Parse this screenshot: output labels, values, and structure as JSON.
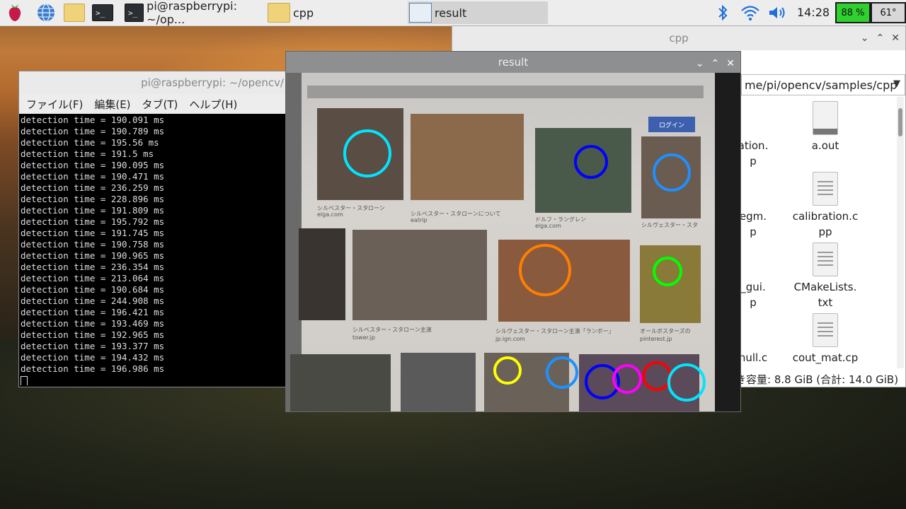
{
  "taskbar": {
    "tasks": [
      {
        "label": "pi@raspberrypi: ~/op..."
      },
      {
        "label": "cpp"
      },
      {
        "label": "result"
      }
    ],
    "clock": "14:28",
    "cpu_usage": "88 %",
    "temperature": "61°"
  },
  "file_manager": {
    "title": "cpp",
    "path": "me/pi/opencv/samples/cpp",
    "files": [
      {
        "name": "ation.",
        "name2": "p"
      },
      {
        "name": "a.out",
        "name2": ""
      },
      {
        "name": "egm.",
        "name2": "p"
      },
      {
        "name": "calibration.c",
        "name2": "pp"
      },
      {
        "name": "_gui.",
        "name2": "p"
      },
      {
        "name": "CMakeLists.",
        "name2": "txt"
      },
      {
        "name": "hull.c",
        "name2": ""
      },
      {
        "name": "cout_mat.cp",
        "name2": ""
      }
    ],
    "status": "き容量: 8.8 GiB (合計: 14.0 GiB)"
  },
  "terminal": {
    "title": "pi@raspberrypi: ~/opencv/",
    "menu": [
      "ファイル(F)",
      "編集(E)",
      "タブ(T)",
      "ヘルプ(H)"
    ],
    "lines": [
      "detection time = 190.091 ms",
      "detection time = 190.789 ms",
      "detection time = 195.56 ms",
      "detection time = 191.5 ms",
      "detection time = 190.095 ms",
      "detection time = 190.471 ms",
      "detection time = 236.259 ms",
      "detection time = 228.896 ms",
      "detection time = 191.809 ms",
      "detection time = 195.792 ms",
      "detection time = 191.745 ms",
      "detection time = 190.758 ms",
      "detection time = 190.965 ms",
      "detection time = 236.354 ms",
      "detection time = 213.064 ms",
      "detection time = 190.684 ms",
      "detection time = 244.908 ms",
      "detection time = 196.421 ms",
      "detection time = 193.469 ms",
      "detection time = 192.965 ms",
      "detection time = 193.377 ms",
      "detection time = 194.432 ms",
      "detection time = 196.986 ms"
    ]
  },
  "result_window": {
    "title": "result",
    "captions": [
      "シルベスター・スタローン",
      "elga.com",
      "シルベスター・スタローンについて",
      "eatrip",
      "ドルフ・ラングレン",
      "elga.com",
      "シルヴェスター・スタ",
      "ログイン",
      "シルベスター・スタローン主演",
      "tower.jp",
      "シルヴェスター・スタローン主演「ランボー」",
      "jp.ign.com",
      "オールボスターズの",
      "pinterest.jp"
    ]
  },
  "colors": {
    "cpu_bg": "#30d030",
    "face_cyan": "#00e5ff",
    "face_blue": "#0000ff",
    "face_azure": "#1e90ff",
    "face_orange": "#ff7f00",
    "face_green": "#00ff00",
    "face_yellow": "#ffff00",
    "face_magenta": "#ff00ff",
    "face_red": "#ff0000"
  }
}
